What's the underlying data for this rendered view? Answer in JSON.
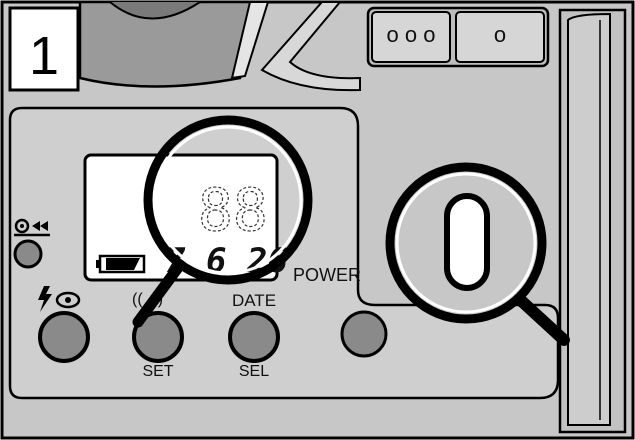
{
  "step_number": "1",
  "labels": {
    "power": "POWER",
    "date": "DATE",
    "set": "SET",
    "sel": "SEL",
    "mode_icon": "(( ·))"
  },
  "lcd": {
    "digits_top": "88",
    "digits_bottom": "7  6 26"
  },
  "top_buttons": [
    "o o o",
    "o"
  ],
  "icons": [
    "flash-red-eye-icon",
    "rewind-icon",
    "battery-icon",
    "magnifier-icon"
  ],
  "colors": {
    "body": "#c7c7c7",
    "panel": "#cfcfcf",
    "outline": "#000000",
    "button": "#8a8a8a"
  }
}
